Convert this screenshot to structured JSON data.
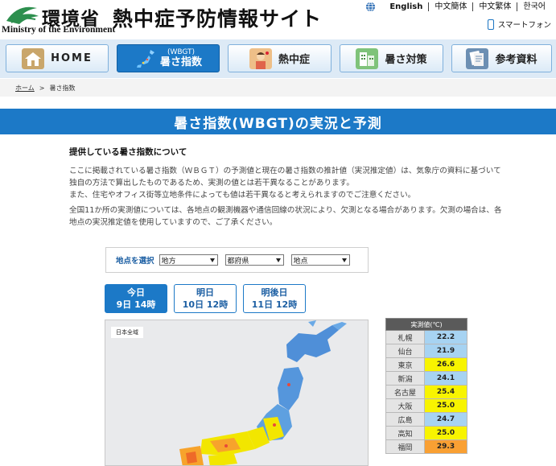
{
  "header": {
    "ministry_jp": "環境省",
    "ministry_en": "Ministry of the Environment",
    "site_title": "熱中症予防情報サイト",
    "languages": [
      "English",
      "中文簡体",
      "中文繁体",
      "한국어"
    ],
    "smartphone_label": "スマートフォン"
  },
  "nav": {
    "items": [
      {
        "label": "HOME",
        "icon": "house-icon"
      },
      {
        "label_small": "(WBGT)",
        "label": "暑さ指数",
        "icon": "japan-map-icon",
        "active": true
      },
      {
        "label": "熱中症",
        "icon": "person-heat-icon"
      },
      {
        "label": "暑さ対策",
        "icon": "building-icon"
      },
      {
        "label": "参考資料",
        "icon": "document-icon"
      }
    ]
  },
  "breadcrumb": {
    "home": "ホーム",
    "separator": ">",
    "current": "暑さ指数"
  },
  "page_title": "暑さ指数(WBGT)の実況と予測",
  "section": {
    "heading": "提供している暑さ指数について",
    "para1": "ここに掲載されている暑さ指数（ＷＢＧＴ）の予測値と現在の暑さ指数の推計値（実況推定値）は、気象庁の資料に基づいて独自の方法で算出したものであるため、実測の値とは若干異なることがあります。\nまた、住宅やオフィス街等立地条件によっても値は若干異なると考えられますのでご注意ください。",
    "para2": "全国11か所の実測値については、各地点の観測機器や通信回線の状況により、欠測となる場合があります。欠測の場合は、各地点の実況推定値を使用していますので、ご了承ください。"
  },
  "selector": {
    "label": "地点を選択",
    "region": "地方",
    "prefecture": "都府県",
    "point": "地点"
  },
  "day_tabs": [
    {
      "line1": "今日",
      "line2": "9日 14時",
      "active": true
    },
    {
      "line1": "明日",
      "line2": "10日 12時"
    },
    {
      "line1": "明後日",
      "line2": "11日 12時"
    }
  ],
  "map": {
    "badge": "日本全域"
  },
  "observed": {
    "header": "実測値(℃)",
    "rows": [
      {
        "city": "札幌",
        "value": "22.2",
        "level": "blue"
      },
      {
        "city": "仙台",
        "value": "21.9",
        "level": "blue"
      },
      {
        "city": "東京",
        "value": "26.6",
        "level": "yellow"
      },
      {
        "city": "新潟",
        "value": "24.1",
        "level": "blue"
      },
      {
        "city": "名古屋",
        "value": "25.4",
        "level": "yellow"
      },
      {
        "city": "大阪",
        "value": "25.0",
        "level": "yellow"
      },
      {
        "city": "広島",
        "value": "24.7",
        "level": "blue"
      },
      {
        "city": "高知",
        "value": "25.0",
        "level": "yellow"
      },
      {
        "city": "福岡",
        "value": "29.3",
        "level": "orange"
      }
    ]
  },
  "colors": {
    "brand_blue": "#1c79c7",
    "level_blue": "#a7d3f2",
    "level_yellow": "#f8f400",
    "level_orange": "#f9a033"
  }
}
